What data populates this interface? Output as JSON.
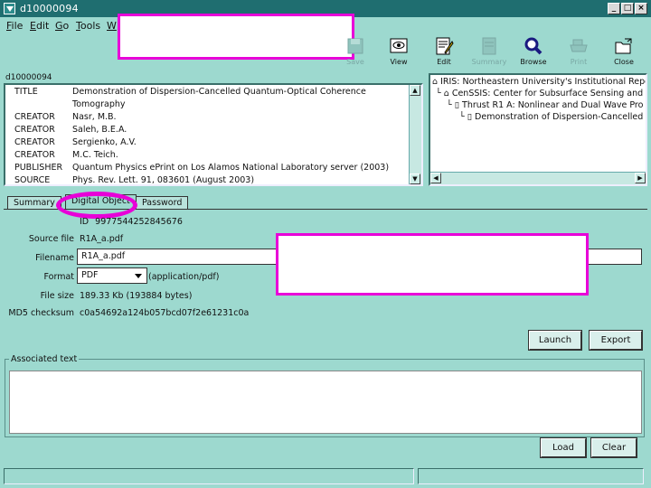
{
  "window": {
    "title": "d10000094",
    "controls": [
      "_",
      "□",
      "×"
    ]
  },
  "menu": [
    {
      "label": "File",
      "u": "F",
      "rest": "ile"
    },
    {
      "label": "Edit",
      "u": "E",
      "rest": "dit"
    },
    {
      "label": "Go",
      "u": "G",
      "rest": "o"
    },
    {
      "label": "Tools",
      "u": "T",
      "rest": "ools"
    },
    {
      "label": "W",
      "u": "W",
      "rest": ""
    }
  ],
  "toolbar": {
    "save": "Save",
    "view": "View",
    "edit": "Edit",
    "summary": "Summary",
    "browse": "Browse",
    "print": "Print",
    "close": "Close"
  },
  "metadata": {
    "record_id": "d10000094",
    "rows": [
      {
        "key": "TITLE",
        "value": "Demonstration of Dispersion-Cancelled Quantum-Optical Coherence"
      },
      {
        "key": "",
        "value": "Tomography"
      },
      {
        "key": "CREATOR",
        "value": "Nasr, M.B."
      },
      {
        "key": "CREATOR",
        "value": "Saleh, B.E.A."
      },
      {
        "key": "CREATOR",
        "value": "Sergienko, A.V."
      },
      {
        "key": "CREATOR",
        "value": "M.C. Teich."
      },
      {
        "key": "PUBLISHER",
        "value": "Quantum Physics ePrint on Los Alamos National Laboratory server (2003)"
      },
      {
        "key": "SOURCE",
        "value": "Phys. Rev. Lett. 91, 083601 (August 2003)"
      }
    ]
  },
  "tree": [
    {
      "text": "IRIS: Northeastern University's Institutional Repos",
      "level": 0
    },
    {
      "text": "CenSSIS: Center for Subsurface Sensing and",
      "level": 1
    },
    {
      "text": "Thrust R1 A: Nonlinear and Dual Wave Pro",
      "level": 2
    },
    {
      "text": "Demonstration of Dispersion-Cancelled",
      "level": 3
    }
  ],
  "tabs": [
    "Summary",
    "Digital Object",
    "Password"
  ],
  "digital_object": {
    "id_label": "ID",
    "id_value": "997754425284567",
    "id_tail": "6",
    "source_label": "Source file",
    "source_value": "R1A_a.pdf",
    "filename_label": "Filename",
    "filename_value": "R1A_a.pdf",
    "format_label": "Format",
    "format_value": "PDF",
    "format_mime": "(application/pdf)",
    "filesize_label": "File size",
    "filesize_value": "189.33 Kb (193884 bytes)",
    "md5_label": "MD5 checksum",
    "md5_value": "c0a54692a124b057bcd07f2e61231c0a",
    "launch": "Launch",
    "export": "Export"
  },
  "associated": {
    "label": "Associated text",
    "load": "Load",
    "clear": "Clear"
  },
  "colors": {
    "background": "#9dd9cf",
    "titlebar": "#1f6e70",
    "annotation": "#e800d8"
  }
}
